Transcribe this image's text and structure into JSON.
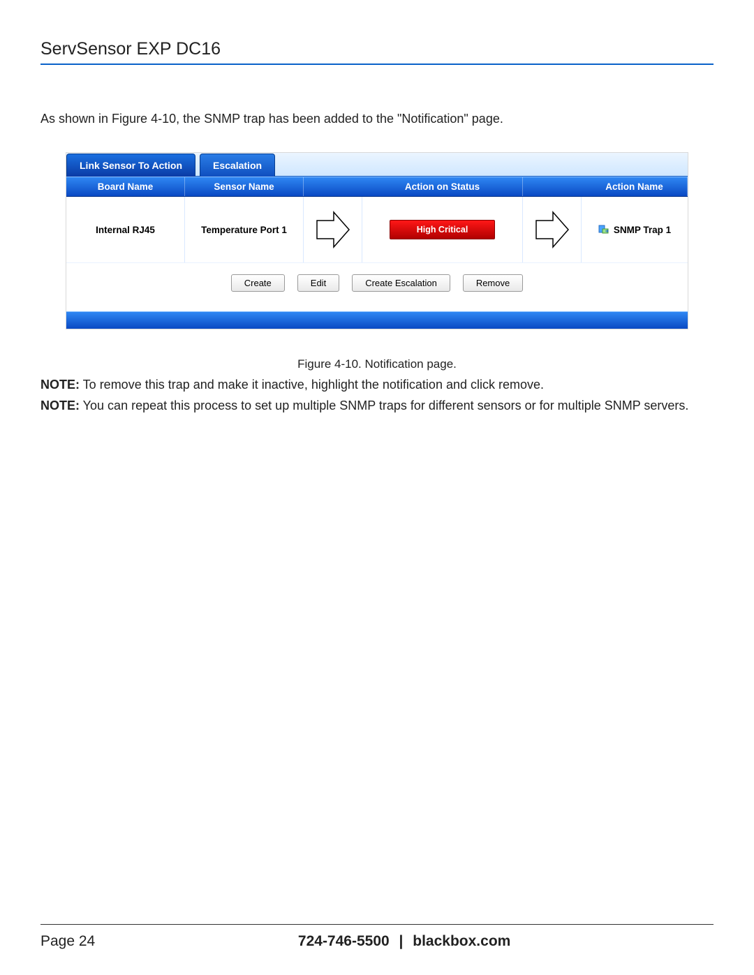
{
  "doc": {
    "title": "ServSensor EXP DC16",
    "intro": "As shown in Figure 4-10, the SNMP trap has been added to the \"Notification\" page.",
    "figure_caption": "Figure 4-10. Notification page.",
    "note1_label": "NOTE:",
    "note1_text": " To remove this trap and make it inactive, highlight the notification and click remove.",
    "note2_label": "NOTE:",
    "note2_text": " You can repeat this process to set up multiple SNMP traps for different sensors or for multiple SNMP servers."
  },
  "tabs": {
    "active": "Link Sensor To Action",
    "inactive": "Escalation"
  },
  "columns": {
    "board": "Board Name",
    "sensor": "Sensor Name",
    "action_status": "Action on Status",
    "action_name": "Action Name"
  },
  "row": {
    "board": "Internal RJ45",
    "sensor": "Temperature Port 1",
    "status": "High Critical",
    "action_name": "SNMP Trap 1"
  },
  "buttons": {
    "create": "Create",
    "edit": "Edit",
    "create_escalation": "Create Escalation",
    "remove": "Remove"
  },
  "footer": {
    "page_label": "Page 24",
    "phone": "724-746-5500",
    "sep": "|",
    "site": "blackbox.com"
  }
}
